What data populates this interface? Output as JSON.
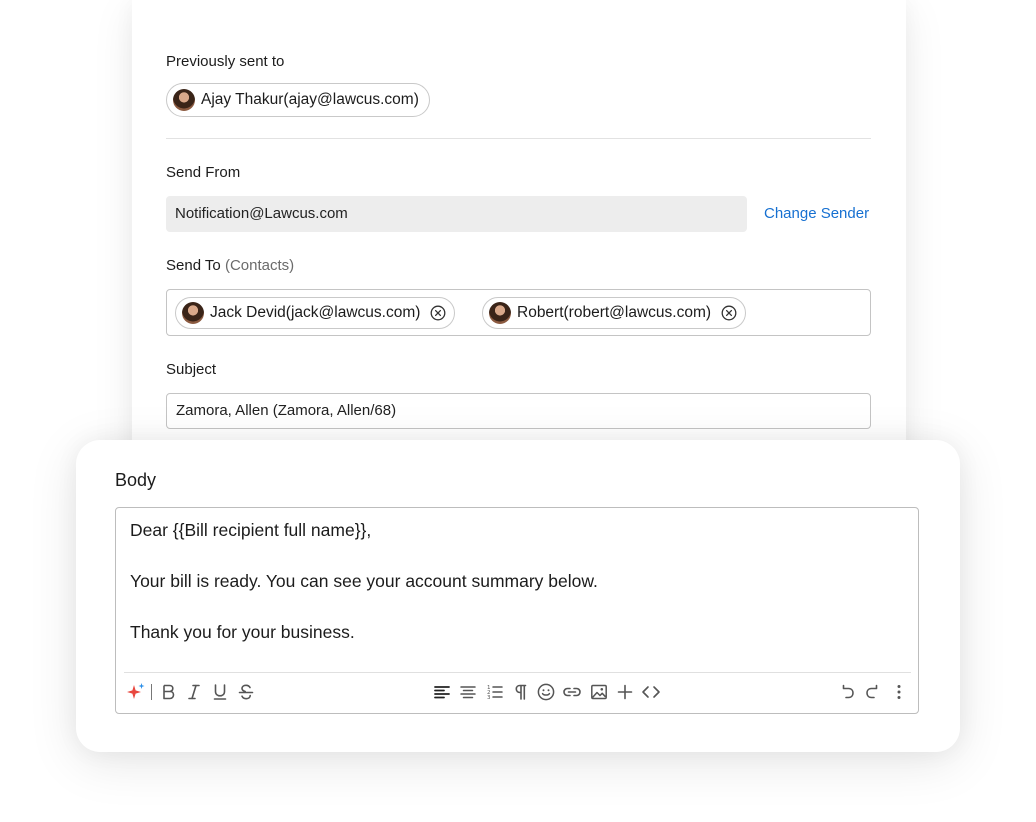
{
  "previously_sent": {
    "label": "Previously sent to",
    "recipients": [
      {
        "text": "Ajay Thakur(ajay@lawcus.com)"
      }
    ]
  },
  "send_from": {
    "label": "Send From",
    "value": "Notification@Lawcus.com",
    "change_sender_label": "Change Sender"
  },
  "send_to": {
    "label": "Send To",
    "sublabel": "(Contacts)",
    "recipients": [
      {
        "text": "Jack Devid(jack@lawcus.com)"
      },
      {
        "text": "Robert(robert@lawcus.com)"
      }
    ]
  },
  "subject": {
    "label": "Subject",
    "value": "Zamora, Allen (Zamora, Allen/68)"
  },
  "body": {
    "label": "Body",
    "lines": [
      "Dear {{Bill recipient full name}},",
      "Your bill is ready. You can see your account summary below.",
      "Thank you for your business."
    ]
  },
  "toolbar": {
    "icons": [
      "ai-sparkle-icon",
      "bold-icon",
      "italic-icon",
      "underline-icon",
      "strikethrough-icon",
      "align-left-icon",
      "align-center-icon",
      "numbered-list-icon",
      "paragraph-icon",
      "emoji-icon",
      "link-icon",
      "image-icon",
      "add-icon",
      "code-icon",
      "undo-icon",
      "redo-icon",
      "more-options-icon"
    ]
  },
  "colors": {
    "link": "#1670d1",
    "sparkle_red": "#e8473f",
    "sparkle_blue": "#2a8ee8"
  }
}
